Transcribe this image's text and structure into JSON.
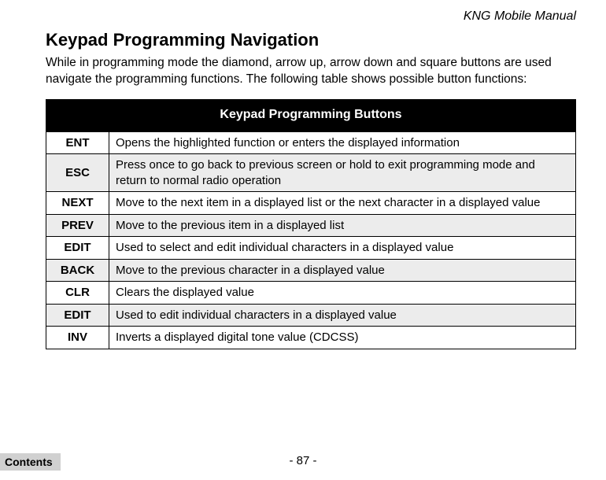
{
  "header": {
    "manual_title": "KNG Mobile Manual"
  },
  "section": {
    "title": "Keypad Programming Navigation",
    "intro": "While in programming mode the diamond, arrow up, arrow down and square buttons are used navigate the programming functions. The following table shows possible button functions:"
  },
  "table": {
    "caption": "Keypad Programming Buttons",
    "rows": [
      {
        "button": "ENT",
        "description": "Opens the highlighted function or enters the displayed information",
        "shaded": false
      },
      {
        "button": "ESC",
        "description": "Press once to go back to previous screen or hold to exit programming mode and return to normal radio operation",
        "shaded": true
      },
      {
        "button": "NEXT",
        "description": "Move to the next item in a displayed list or the next character in a displayed value",
        "shaded": false
      },
      {
        "button": "PREV",
        "description": "Move to the previous item in a displayed list",
        "shaded": true
      },
      {
        "button": "EDIT",
        "description": "Used to select and edit individual characters in a displayed value",
        "shaded": false
      },
      {
        "button": "BACK",
        "description": "Move to the previous character in a displayed value",
        "shaded": true
      },
      {
        "button": "CLR",
        "description": "Clears the displayed value",
        "shaded": false
      },
      {
        "button": "EDIT",
        "description": "Used to edit individual characters in a displayed value",
        "shaded": true
      },
      {
        "button": "INV",
        "description": "Inverts a displayed digital tone value (CDCSS)",
        "shaded": false
      }
    ]
  },
  "footer": {
    "page_number": "- 87 -",
    "contents_label": "Contents"
  }
}
